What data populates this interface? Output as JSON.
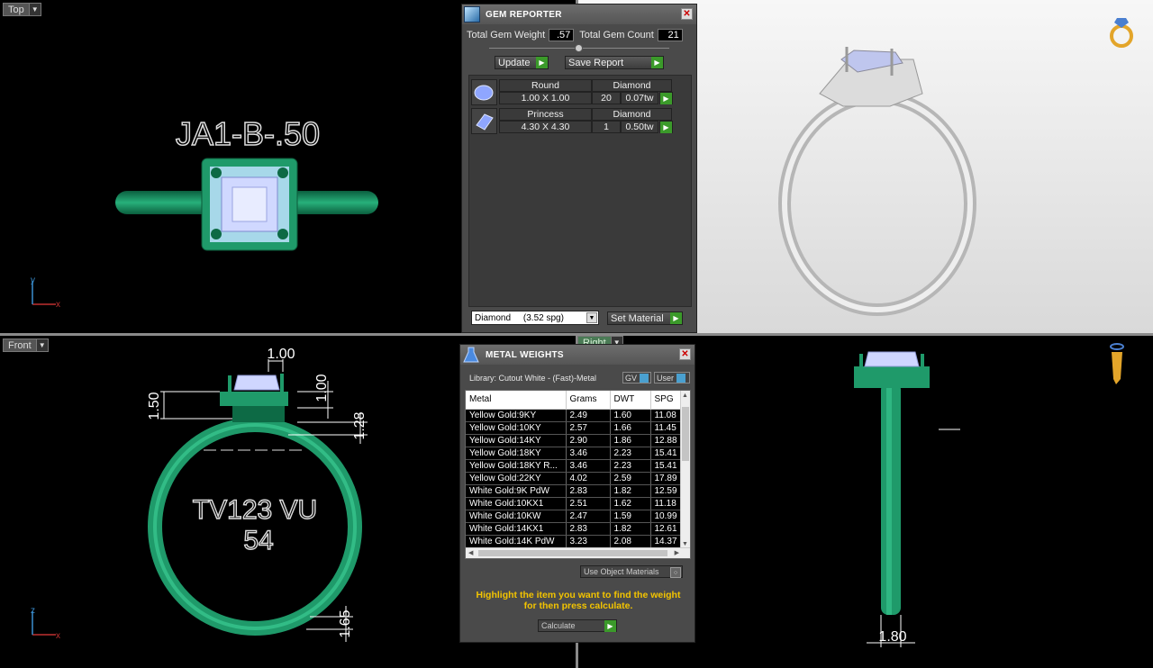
{
  "viewports": {
    "top": {
      "label": "Top",
      "engraving": "JA1-B-.50",
      "axis_x": "x",
      "axis_y": "y"
    },
    "front": {
      "label": "Front",
      "engraving_line1": "TV123 VU",
      "engraving_line2": "54",
      "dims": {
        "top_width": "1.00",
        "left": "1.50",
        "mid": "1.00",
        "right": "1.28",
        "bottom": "1.65"
      },
      "axis_x": "x",
      "axis_z": "z"
    },
    "right": {
      "label": "Right",
      "dim_bottom": "1.80"
    }
  },
  "gem_reporter": {
    "title": "GEM REPORTER",
    "total_weight_label": "Total Gem Weight",
    "total_weight_value": ".57",
    "total_count_label": "Total Gem Count",
    "total_count_value": "21",
    "update_label": "Update",
    "save_report_label": "Save Report",
    "gems": [
      {
        "cut": "Round",
        "material": "Diamond",
        "size": "1.00 X 1.00",
        "count": "20",
        "weight": "0.07tw"
      },
      {
        "cut": "Princess",
        "material": "Diamond",
        "size": "4.30 X 4.30",
        "count": "1",
        "weight": "0.50tw"
      }
    ],
    "material_select": "Diamond     (3.52 spg)",
    "set_material_label": "Set Material"
  },
  "metal_weights": {
    "title": "METAL WEIGHTS",
    "library": "Library: Cutout White - (Fast)-Metal",
    "toggle_gv": "GV",
    "toggle_user": "User",
    "columns": [
      "Metal",
      "Grams",
      "DWT",
      "SPG"
    ],
    "rows": [
      [
        "Yellow Gold:9KY",
        "2.49",
        "1.60",
        "11.08"
      ],
      [
        "Yellow Gold:10KY",
        "2.57",
        "1.66",
        "11.45"
      ],
      [
        "Yellow Gold:14KY",
        "2.90",
        "1.86",
        "12.88"
      ],
      [
        "Yellow Gold:18KY",
        "3.46",
        "2.23",
        "15.41"
      ],
      [
        "Yellow Gold:18KY R...",
        "3.46",
        "2.23",
        "15.41"
      ],
      [
        "Yellow Gold:22KY",
        "4.02",
        "2.59",
        "17.89"
      ],
      [
        "White Gold:9K PdW",
        "2.83",
        "1.82",
        "12.59"
      ],
      [
        "White Gold:10KX1",
        "2.51",
        "1.62",
        "11.18"
      ],
      [
        "White Gold:10KW",
        "2.47",
        "1.59",
        "10.99"
      ],
      [
        "White Gold:14KX1",
        "2.83",
        "1.82",
        "12.61"
      ],
      [
        "White Gold:14K PdW",
        "3.23",
        "2.08",
        "14.37"
      ]
    ],
    "use_object_materials": "Use Object Materials",
    "hint": "Highlight the item you want to find the weight for then press calculate.",
    "calculate_label": "Calculate"
  },
  "colors": {
    "ring_green": "#1f9a6a",
    "gold": "#e3a52a",
    "hint_yellow": "#f3c400"
  }
}
